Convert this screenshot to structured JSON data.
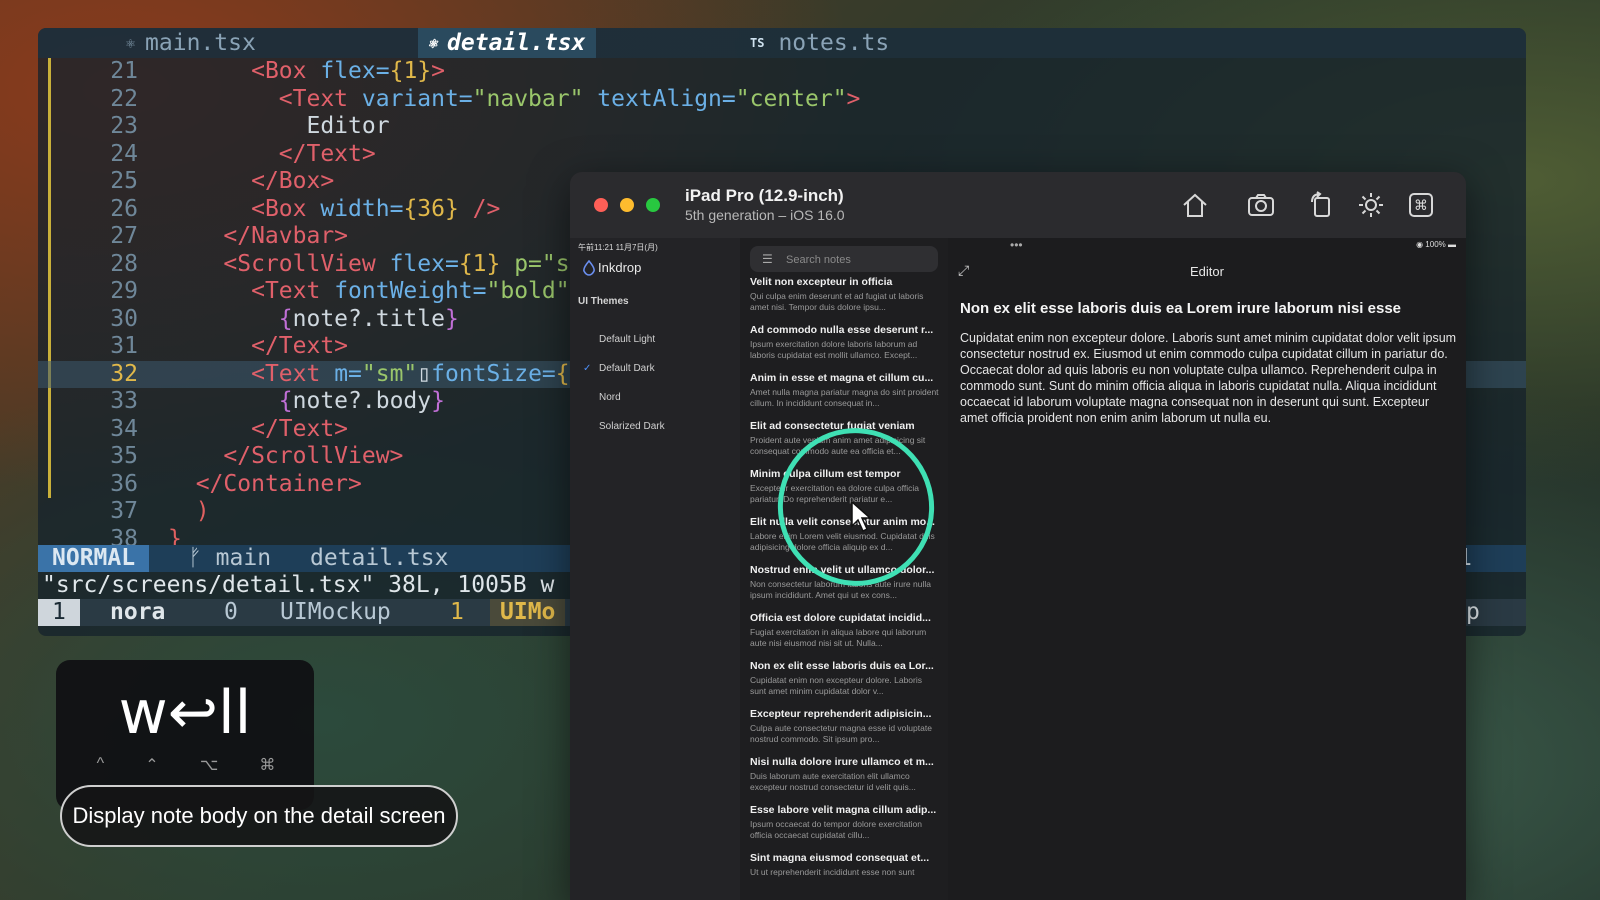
{
  "editor": {
    "tabs": [
      {
        "name": "main.tsx"
      },
      {
        "name": "detail.tsx"
      },
      {
        "badge": "TS",
        "name": "notes.ts"
      }
    ],
    "lines": [
      {
        "n": "21",
        "parts": [
          [
            "      ",
            ""
          ],
          [
            "<Box ",
            "tag"
          ],
          [
            "flex=",
            "attr"
          ],
          [
            "{1}",
            "brace"
          ],
          [
            ">",
            "tag"
          ]
        ]
      },
      {
        "n": "22",
        "parts": [
          [
            "        ",
            ""
          ],
          [
            "<Text ",
            "tag"
          ],
          [
            "variant=",
            "attr"
          ],
          [
            "\"navbar\" ",
            "str"
          ],
          [
            "textAlign=",
            "attr"
          ],
          [
            "\"center\"",
            "str"
          ],
          [
            ">",
            "tag"
          ]
        ]
      },
      {
        "n": "23",
        "parts": [
          [
            "          Editor",
            ""
          ]
        ]
      },
      {
        "n": "24",
        "parts": [
          [
            "        ",
            ""
          ],
          [
            "</Text>",
            "tag"
          ]
        ]
      },
      {
        "n": "25",
        "parts": [
          [
            "      ",
            ""
          ],
          [
            "</Box>",
            "tag"
          ]
        ]
      },
      {
        "n": "26",
        "parts": [
          [
            "      ",
            ""
          ],
          [
            "<Box ",
            "tag"
          ],
          [
            "width=",
            "attr"
          ],
          [
            "{36}",
            "brace"
          ],
          [
            " />",
            "tag"
          ]
        ]
      },
      {
        "n": "27",
        "parts": [
          [
            "    ",
            ""
          ],
          [
            "</Navbar>",
            "tag"
          ]
        ]
      },
      {
        "n": "28",
        "parts": [
          [
            "    ",
            ""
          ],
          [
            "<ScrollView ",
            "tag"
          ],
          [
            "flex=",
            "attr"
          ],
          [
            "{1}",
            "brace"
          ],
          [
            " p=\"s",
            "str"
          ]
        ]
      },
      {
        "n": "29",
        "parts": [
          [
            "      ",
            ""
          ],
          [
            "<Text ",
            "tag"
          ],
          [
            "fontWeight=",
            "attr"
          ],
          [
            "\"bold\"",
            "str"
          ]
        ]
      },
      {
        "n": "30",
        "parts": [
          [
            "        ",
            ""
          ],
          [
            "{",
            "br2"
          ],
          [
            "note?.title",
            ""
          ],
          [
            "}",
            "br2"
          ]
        ]
      },
      {
        "n": "31",
        "parts": [
          [
            "      ",
            ""
          ],
          [
            "</Text>",
            "tag"
          ]
        ]
      },
      {
        "n": "32",
        "parts": [
          [
            "      ",
            ""
          ],
          [
            "<Text ",
            "tag"
          ],
          [
            "m=",
            "attr"
          ],
          [
            "\"sm\"",
            "str"
          ],
          [
            "▯",
            ""
          ],
          [
            "fontSize=",
            "attr"
          ],
          [
            "{",
            "brace"
          ]
        ],
        "current": true
      },
      {
        "n": "33",
        "parts": [
          [
            "        ",
            ""
          ],
          [
            "{",
            "br2"
          ],
          [
            "note?.body",
            ""
          ],
          [
            "}",
            "br2"
          ]
        ]
      },
      {
        "n": "34",
        "parts": [
          [
            "      ",
            ""
          ],
          [
            "</Text>",
            "tag"
          ]
        ]
      },
      {
        "n": "35",
        "parts": [
          [
            "    ",
            ""
          ],
          [
            "</ScrollView>",
            "tag"
          ]
        ]
      },
      {
        "n": "36",
        "parts": [
          [
            "  ",
            ""
          ],
          [
            "</Container>",
            "tag"
          ]
        ]
      },
      {
        "n": "37",
        "parts": [
          [
            "  ",
            ""
          ],
          [
            ")",
            "br3"
          ]
        ]
      },
      {
        "n": "38",
        "parts": [
          [
            "",
            ""
          ],
          [
            "}",
            "br3"
          ]
        ]
      }
    ],
    "status": {
      "mode": "NORMAL",
      "branch": "ᚠ main",
      "file": "detail.tsx",
      "right": "1"
    },
    "cmdline": "\"src/screens/detail.tsx\" 38L, 1005B w",
    "tmux": {
      "win": "1",
      "session": "nora",
      "idx": "0",
      "name": "UIMockup",
      "idx2": "1",
      "name2": "UIMo",
      "right": "p"
    }
  },
  "keys": {
    "pressed": "w↩ll",
    "mods": [
      "^",
      "⌃",
      "⌥",
      "⌘"
    ]
  },
  "caption": "Display note body on the detail screen",
  "simulator": {
    "device_name": "iPad Pro (12.9-inch)",
    "device_sub": "5th generation – iOS 16.0",
    "status_time": "午前11:21  11月7日(月)",
    "battery": "100%",
    "app_name": "Inkdrop",
    "section": "UI Themes",
    "themes": [
      {
        "label": "Default Light",
        "checked": false
      },
      {
        "label": "Default Dark",
        "checked": true
      },
      {
        "label": "Nord",
        "checked": false
      },
      {
        "label": "Solarized Dark",
        "checked": false
      }
    ],
    "search_placeholder": "Search notes",
    "notes": [
      {
        "title": "Velit non excepteur in officia",
        "body": "Qui culpa enim deserunt et ad fugiat ut laboris amet nisi. Tempor duis dolore ipsu..."
      },
      {
        "title": "Ad commodo nulla esse deserunt r...",
        "body": "Ipsum exercitation dolore laboris laborum ad laboris cupidatat est mollit ullamco. Except..."
      },
      {
        "title": "Anim in esse et magna et cillum cu...",
        "body": "Amet nulla magna pariatur magna do sint proident cillum. In incididunt consequat in..."
      },
      {
        "title": "Elit ad consectetur fugiat veniam",
        "body": "Proident aute veniam anim amet adipisicing sit consequat commodo aute ea officia et..."
      },
      {
        "title": "Minim culpa cillum est tempor",
        "body": "Excepteur exercitation ea dolore culpa officia pariatur. Do reprehenderit pariatur e..."
      },
      {
        "title": "Elit nulla velit consectetur anim mo...",
        "body": "Labore enim Lorem velit eiusmod. Cupidatat duis adipisicing dolore officia aliquip ex d..."
      },
      {
        "title": "Nostrud enim velit ut ullamco dolor...",
        "body": "Non consectetur laborum laboris aute irure nulla ipsum incididunt. Amet qui ut ex cons..."
      },
      {
        "title": "Officia est dolore cupidatat incidid...",
        "body": "Fugiat exercitation in aliqua labore qui laborum aute nisi eiusmod nisi sit ut. Nulla..."
      },
      {
        "title": "Non ex elit esse laboris duis ea Lor...",
        "body": "Cupidatat enim non excepteur dolore. Laboris sunt amet minim cupidatat dolor v..."
      },
      {
        "title": "Excepteur reprehenderit adipisicin...",
        "body": "Culpa aute consectetur magna esse id voluptate nostrud commodo. Sit ipsum pro..."
      },
      {
        "title": "Nisi nulla dolore irure ullamco et m...",
        "body": "Duis laborum aute exercitation elit ullamco excepteur nostrud consectetur id velit quis..."
      },
      {
        "title": "Esse labore velit magna cillum adip...",
        "body": "Ipsum occaecat do tempor dolore exercitation officia occaecat cupidatat cillu..."
      },
      {
        "title": "Sint magna eiusmod consequat et...",
        "body": "Ut ut reprehenderit incididunt esse non sunt"
      }
    ],
    "editor_title": "Editor",
    "note_heading": "Non ex elit esse laboris duis ea Lorem irure laborum nisi esse",
    "note_body": "Cupidatat enim non excepteur dolore. Laboris sunt amet minim cupidatat dolor velit ipsum consectetur nostrud ex. Eiusmod ut enim commodo culpa cupidatat cillum in pariatur do. Occaecat dolor ad quis laboris eu non voluptate culpa ullamco. Reprehenderit culpa in commodo sunt. Sunt do minim officia aliqua in laboris cupidatat nulla. Aliqua incididunt occaecat id laborum voluptate magna consequat non in deserunt qui sunt. Excepteur amet officia proident non enim anim laborum ut nulla eu."
  },
  "colors": {
    "accent": "#3fe0b4",
    "nvim_mode": "#3a73a8",
    "tag": "#e0606a",
    "attr": "#6bb0e6",
    "string": "#9ac66b"
  }
}
